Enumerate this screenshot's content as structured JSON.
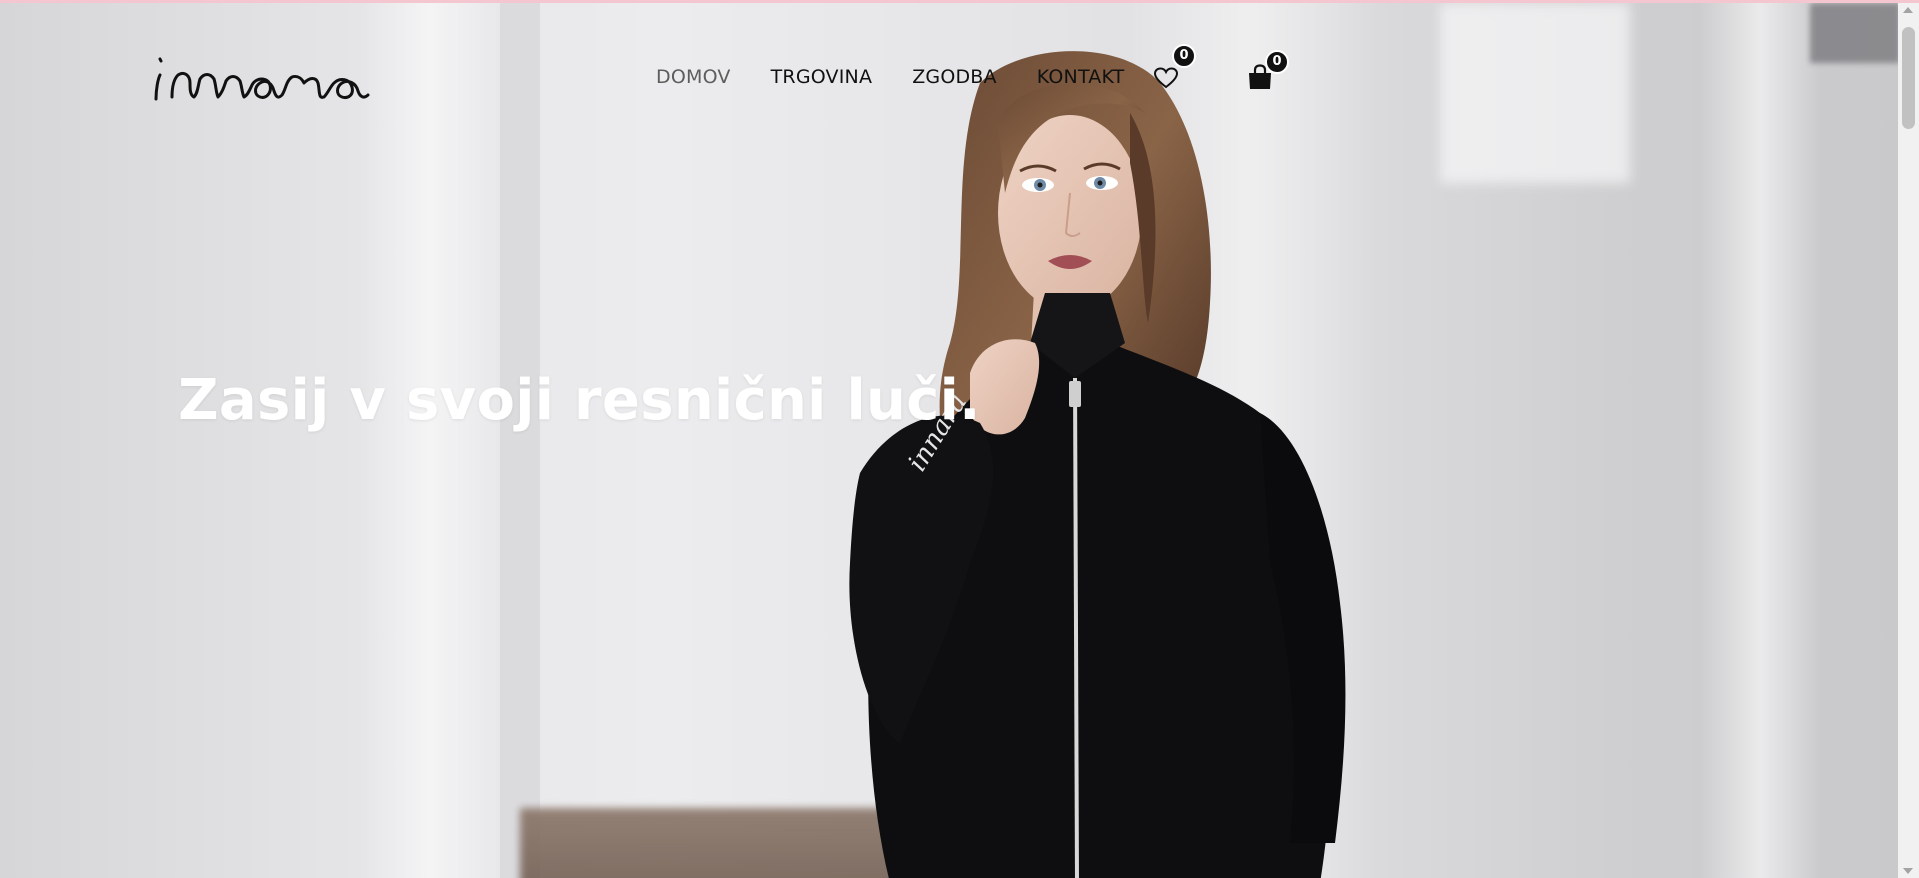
{
  "brand": {
    "logo_text": "innara"
  },
  "nav": {
    "items": [
      {
        "label": "DOMOV",
        "active": true
      },
      {
        "label": "TRGOVINA",
        "active": false
      },
      {
        "label": "ZGODBA",
        "active": false
      },
      {
        "label": "KONTAKT",
        "active": false
      }
    ],
    "wishlist": {
      "icon": "heart-icon",
      "count": "0"
    },
    "cart": {
      "icon": "shopping-bag-icon",
      "count": "0"
    }
  },
  "hero": {
    "headline": "Zasij v svoji resnični luči.",
    "image": "model-in-black-zip-jacket"
  },
  "colors": {
    "accent_top": "#f4c6cf",
    "text_dark": "#111111",
    "active_nav": "#5d5d5d",
    "headline": "#ffffff"
  }
}
